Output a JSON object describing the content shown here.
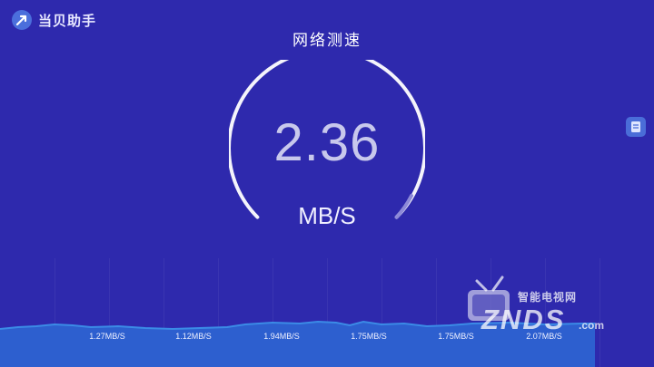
{
  "app": {
    "name": "当贝助手"
  },
  "header": {
    "title": "网络测速"
  },
  "speedometer": {
    "value": "2.36",
    "unit": "MB/S",
    "progress": 0.92
  },
  "throughput": {
    "labels": [
      "1.27MB/S",
      "1.12MB/S",
      "1.94MB/S",
      "1.75MB/S",
      "1.75MB/S",
      "2.07MB/S"
    ]
  },
  "watermark": {
    "main": "ZNDS",
    "sub": "智能电视网",
    "suffix": ".com"
  },
  "colors": {
    "background": "#2e29ad",
    "arc": "#ffffff",
    "graph_line": "#3b8be6",
    "graph_fill": "#2d5fcf"
  },
  "icons": {
    "logo": "rocket-icon",
    "side": "document-icon"
  }
}
